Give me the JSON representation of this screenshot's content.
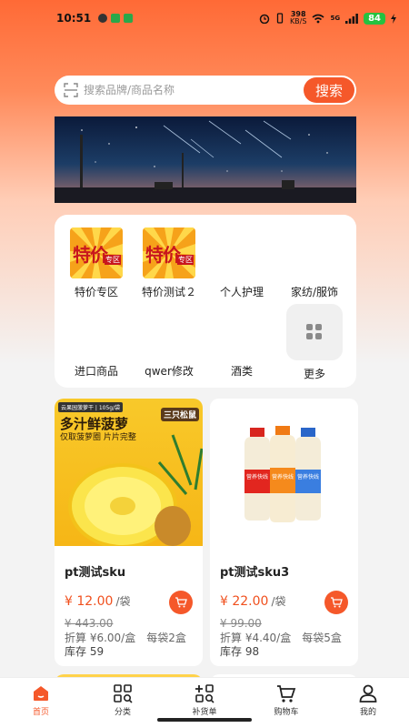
{
  "status_bar": {
    "time": "10:51",
    "net_speed": "398",
    "net_unit": "KB/S",
    "signal_type": "5G",
    "battery": "84"
  },
  "search": {
    "placeholder": "搜索品牌/商品名称",
    "button_label": "搜索"
  },
  "categories": [
    {
      "label": "特价专区",
      "badge_big": "特价",
      "badge_small": "专区"
    },
    {
      "label": "特价测试２",
      "badge_big": "特价",
      "badge_small": "专区"
    },
    {
      "label": "个人护理"
    },
    {
      "label": "家纺/服饰"
    },
    {
      "label": "进口商品"
    },
    {
      "label": "qwer修改"
    },
    {
      "label": "酒类"
    },
    {
      "label": "更多"
    }
  ],
  "products": [
    {
      "name": "pt测试sku",
      "price": "¥ 12.00",
      "unit": "/袋",
      "original_price": "¥ 443.00",
      "conversion": "折算 ¥6.00/盒　每袋2盒",
      "stock": "库存 59",
      "image_text": {
        "tag_left": "云果园菠萝干",
        "tag_weight": "105g/袋",
        "brand": "三只松鼠",
        "headline": "多汁鲜菠萝",
        "subline": "仅取菠萝圈 片片完整"
      }
    },
    {
      "name": "pt测试sku3",
      "price": "¥ 22.00",
      "unit": "/袋",
      "original_price": "¥ 99.00",
      "conversion": "折算 ¥4.40/盒　每袋5盒",
      "stock": "库存 98",
      "image_text": {
        "bottle_label": "营养快线"
      }
    }
  ],
  "tab_bar": [
    {
      "label": "首页",
      "icon": "home-icon",
      "active": true
    },
    {
      "label": "分类",
      "icon": "category-search-icon"
    },
    {
      "label": "补货单",
      "icon": "restock-icon"
    },
    {
      "label": "购物车",
      "icon": "cart-icon"
    },
    {
      "label": "我的",
      "icon": "user-icon"
    }
  ],
  "colors": {
    "accent": "#f5582a",
    "price": "#f0501e",
    "header_gradient_top": "#ff6a36"
  }
}
